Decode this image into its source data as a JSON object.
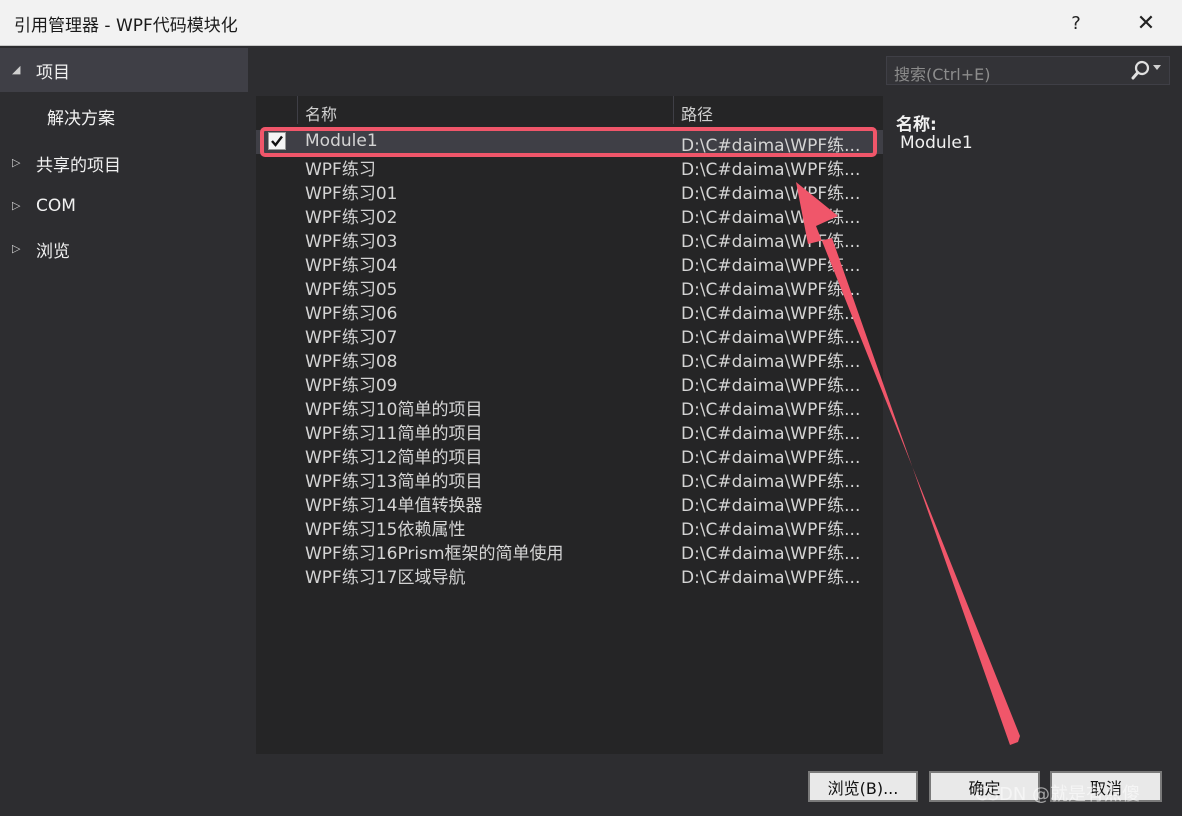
{
  "window": {
    "title": "引用管理器 - WPF代码模块化",
    "help_label": "?",
    "close_label": "✕"
  },
  "sidebar": {
    "items": [
      {
        "label": "项目",
        "arrow": "◢"
      },
      {
        "label": "解决方案",
        "arrow": ""
      },
      {
        "label": "共享的项目",
        "arrow": "▷"
      },
      {
        "label": "COM",
        "arrow": "▷"
      },
      {
        "label": "浏览",
        "arrow": "▷"
      }
    ]
  },
  "search": {
    "placeholder": "搜索(Ctrl+E)",
    "icon": "search-icon"
  },
  "list": {
    "columns": [
      "名称",
      "路径"
    ],
    "rows": [
      {
        "name": "Module1",
        "path": "D:\\C#daima\\WPF练...",
        "checked": true
      },
      {
        "name": "WPF练习",
        "path": "D:\\C#daima\\WPF练...",
        "checked": false
      },
      {
        "name": "WPF练习01",
        "path": "D:\\C#daima\\WPF练...",
        "checked": false
      },
      {
        "name": "WPF练习02",
        "path": "D:\\C#daima\\WPF练...",
        "checked": false
      },
      {
        "name": "WPF练习03",
        "path": "D:\\C#daima\\WPF练...",
        "checked": false
      },
      {
        "name": "WPF练习04",
        "path": "D:\\C#daima\\WPF练...",
        "checked": false
      },
      {
        "name": "WPF练习05",
        "path": "D:\\C#daima\\WPF练...",
        "checked": false
      },
      {
        "name": "WPF练习06",
        "path": "D:\\C#daima\\WPF练...",
        "checked": false
      },
      {
        "name": "WPF练习07",
        "path": "D:\\C#daima\\WPF练...",
        "checked": false
      },
      {
        "name": "WPF练习08",
        "path": "D:\\C#daima\\WPF练...",
        "checked": false
      },
      {
        "name": "WPF练习09",
        "path": "D:\\C#daima\\WPF练...",
        "checked": false
      },
      {
        "name": "WPF练习10简单的项目",
        "path": "D:\\C#daima\\WPF练...",
        "checked": false
      },
      {
        "name": "WPF练习11简单的项目",
        "path": "D:\\C#daima\\WPF练...",
        "checked": false
      },
      {
        "name": "WPF练习12简单的项目",
        "path": "D:\\C#daima\\WPF练...",
        "checked": false
      },
      {
        "name": "WPF练习13简单的项目",
        "path": "D:\\C#daima\\WPF练...",
        "checked": false
      },
      {
        "name": "WPF练习14单值转换器",
        "path": "D:\\C#daima\\WPF练...",
        "checked": false
      },
      {
        "name": "WPF练习15依赖属性",
        "path": "D:\\C#daima\\WPF练...",
        "checked": false
      },
      {
        "name": "WPF练习16Prism框架的简单使用",
        "path": "D:\\C#daima\\WPF练...",
        "checked": false
      },
      {
        "name": "WPF练习17区域导航",
        "path": "D:\\C#daima\\WPF练...",
        "checked": false
      }
    ]
  },
  "detail": {
    "label": "名称:",
    "value": "Module1"
  },
  "buttons": {
    "browse": "浏览(B)...",
    "ok": "确定",
    "cancel": "取消"
  },
  "watermark": "CSDN @就是有点傻",
  "colors": {
    "background": "#2d2d30",
    "list_background": "#252526",
    "selected_row": "#3f3f46",
    "annotation": "#f0566a"
  }
}
